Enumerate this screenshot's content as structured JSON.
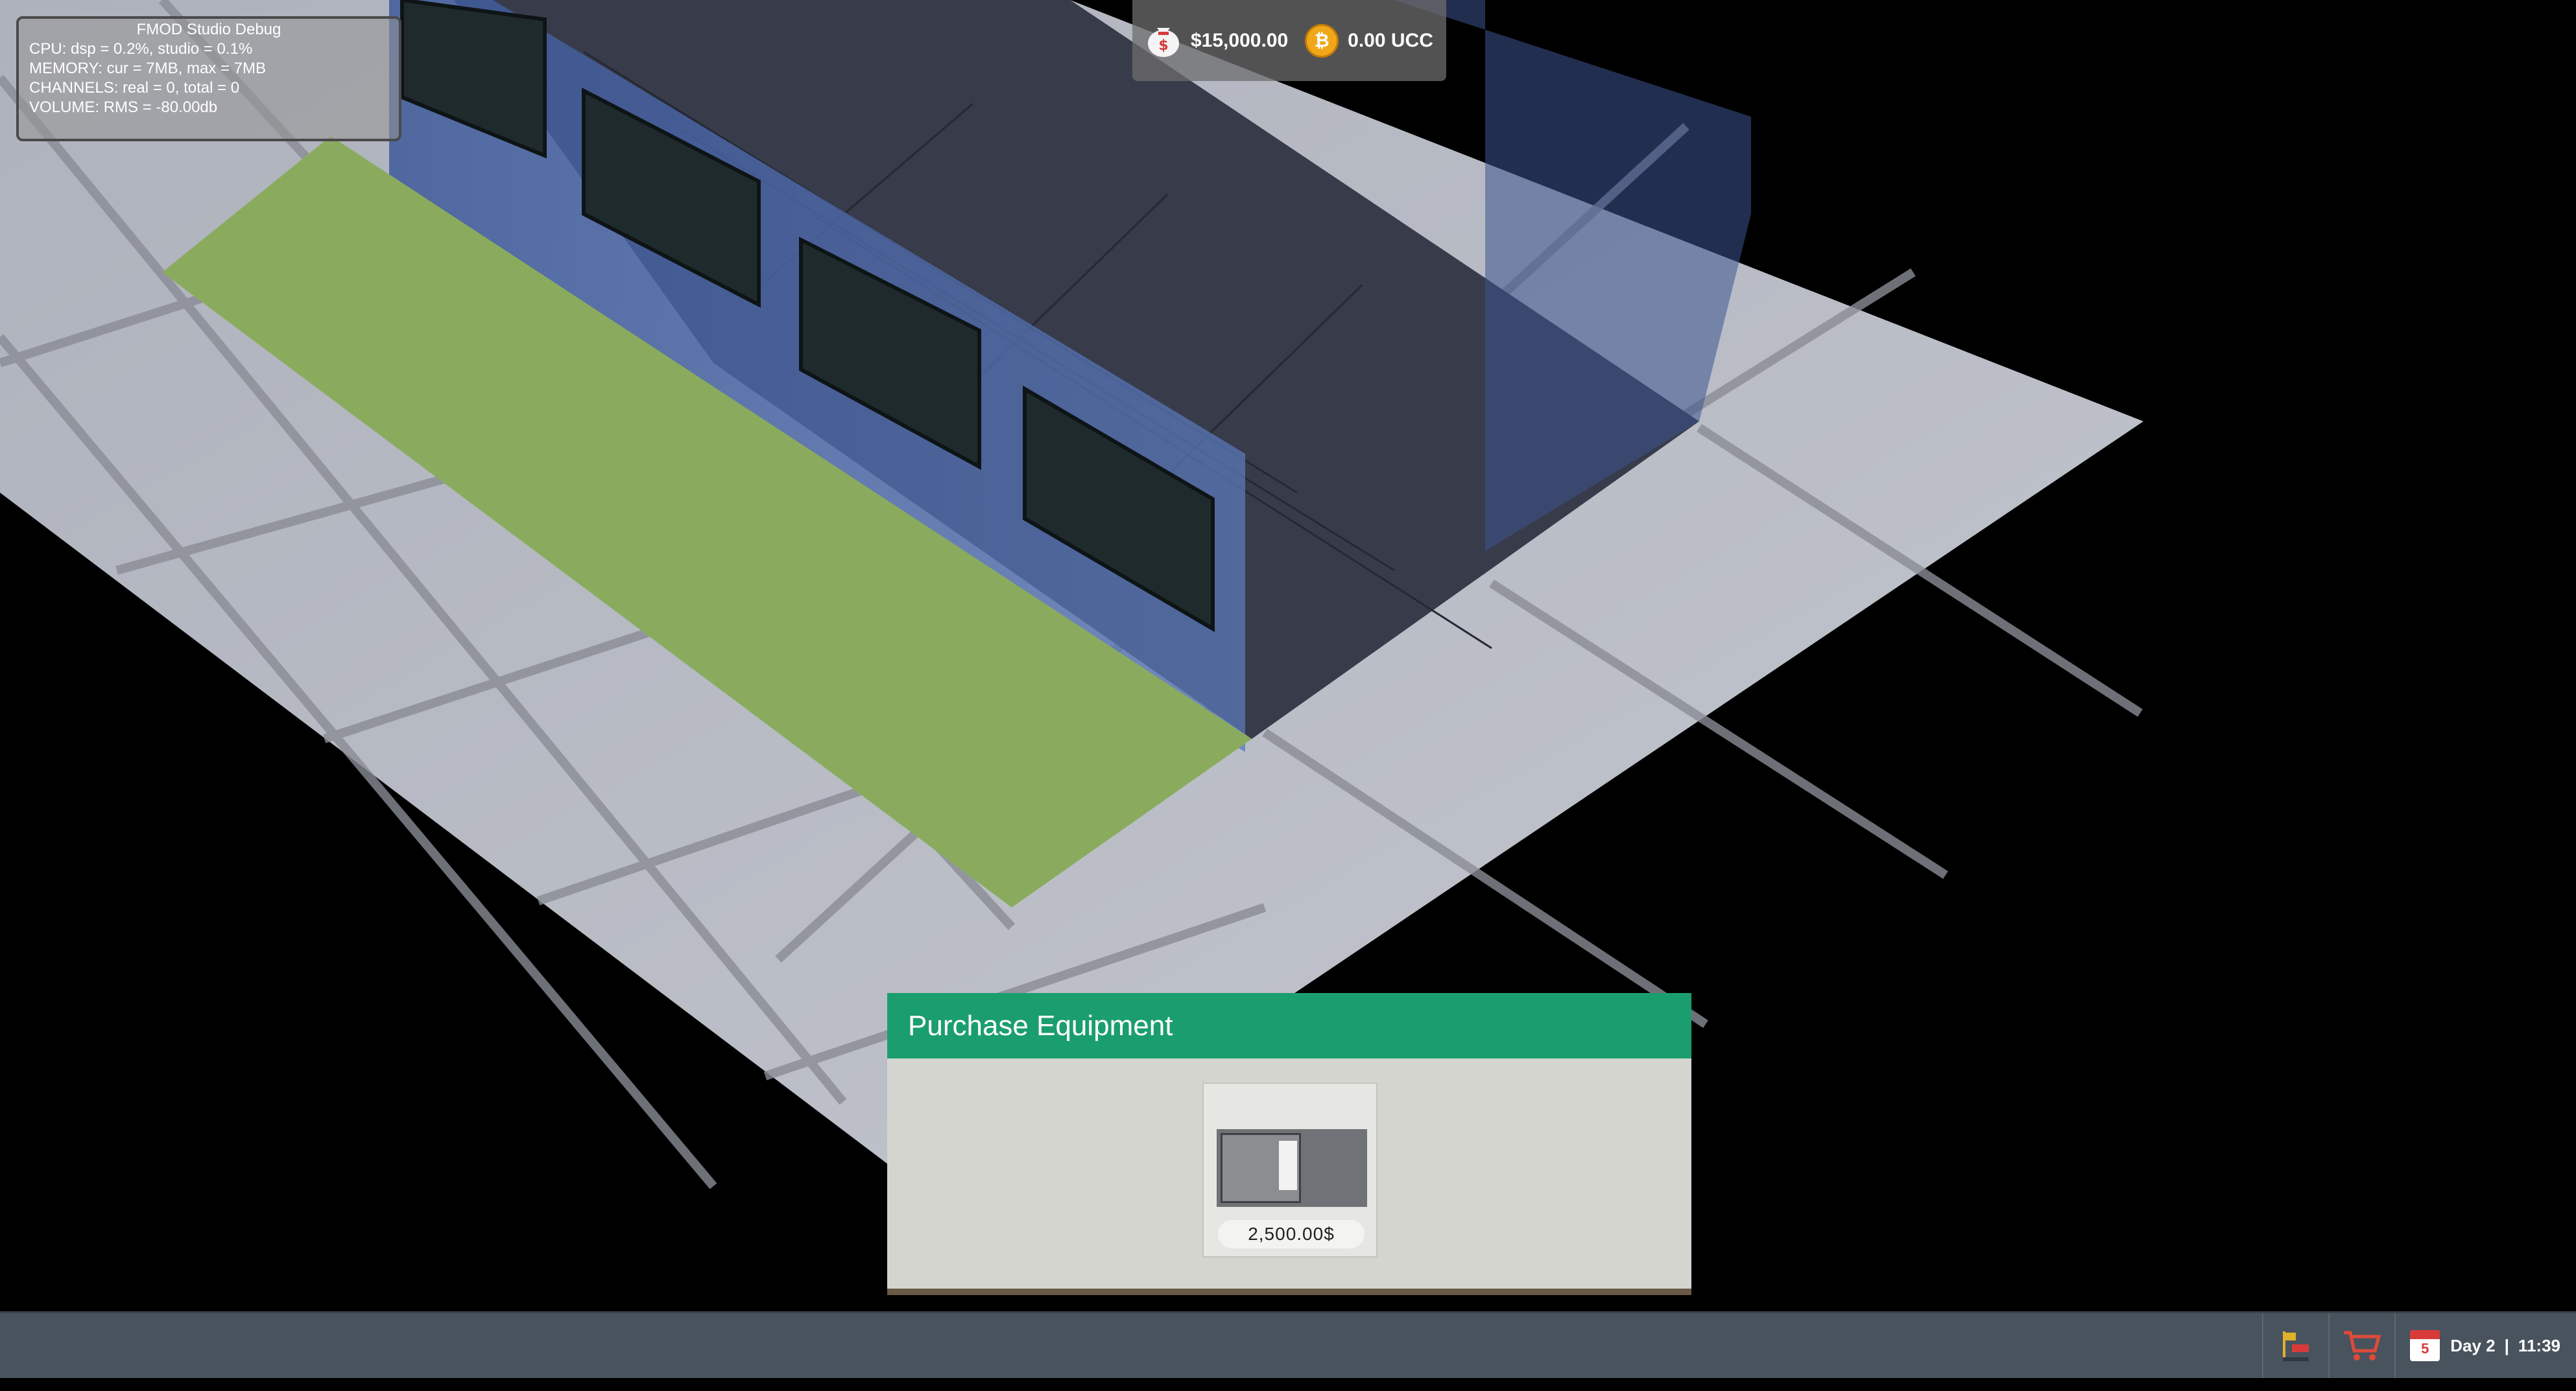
{
  "debug": {
    "title": "FMOD Studio Debug",
    "cpu": "CPU: dsp = 0.2%, studio = 0.1%",
    "memory": "MEMORY: cur = 7MB, max = 7MB",
    "channels": "CHANNELS: real = 0, total = 0",
    "volume": "VOLUME: RMS = -80.00db"
  },
  "hud": {
    "money": "$15,000.00",
    "currency": "0.00 UCC",
    "money_icon": "money-bag-icon",
    "coin_icon": "coin-icon",
    "coin_symbol": "₿"
  },
  "panel": {
    "title": "Purchase Equipment",
    "items": [
      {
        "name": "server-rack",
        "price": "2,500.00$"
      }
    ]
  },
  "bottom_bar": {
    "tools": [
      "build-flag-icon",
      "shopping-cart-icon"
    ],
    "calendar_day_num": "5",
    "day": "Day 2",
    "separator": "|",
    "time": "11:39"
  },
  "colors": {
    "panel_header": "#1b9e6e",
    "grass": "#8aab5e",
    "floor_tile": "#b9bcc6",
    "bottom_bar": "#48535d"
  }
}
